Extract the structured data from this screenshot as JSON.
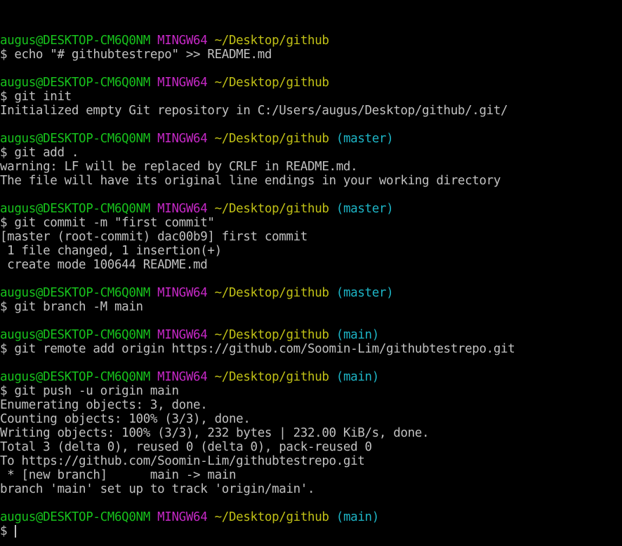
{
  "prompt": {
    "user": "augus@DESKTOP-CM6Q0NM",
    "system": "MINGW64",
    "path": "~/Desktop/github",
    "symbol": "$"
  },
  "colors": {
    "background": "#000000",
    "text": "#c0c0c0",
    "user": "#17c21c",
    "system": "#c528c5",
    "path": "#c0c016",
    "branch": "#1db4c5"
  },
  "blocks": [
    {
      "branch": "",
      "command": "echo \"# githubtestrepo\" >> README.md",
      "output": []
    },
    {
      "branch": "",
      "command": "git init",
      "output": [
        "Initialized empty Git repository in C:/Users/augus/Desktop/github/.git/"
      ]
    },
    {
      "branch": "(master)",
      "command": "git add .",
      "output": [
        "warning: LF will be replaced by CRLF in README.md.",
        "The file will have its original line endings in your working directory"
      ]
    },
    {
      "branch": "(master)",
      "command": "git commit -m \"first commit\"",
      "output": [
        "[master (root-commit) dac00b9] first commit",
        " 1 file changed, 1 insertion(+)",
        " create mode 100644 README.md"
      ]
    },
    {
      "branch": "(master)",
      "command": "git branch -M main",
      "output": []
    },
    {
      "branch": "(main)",
      "command": "git remote add origin https://github.com/Soomin-Lim/githubtestrepo.git",
      "output": []
    },
    {
      "branch": "(main)",
      "command": "git push -u origin main",
      "output": [
        "Enumerating objects: 3, done.",
        "Counting objects: 100% (3/3), done.",
        "Writing objects: 100% (3/3), 232 bytes | 232.00 KiB/s, done.",
        "Total 3 (delta 0), reused 0 (delta 0), pack-reused 0",
        "To https://github.com/Soomin-Lim/githubtestrepo.git",
        " * [new branch]      main -> main",
        "branch 'main' set up to track 'origin/main'."
      ]
    },
    {
      "branch": "(main)",
      "command": "",
      "output": [],
      "active": true
    }
  ]
}
